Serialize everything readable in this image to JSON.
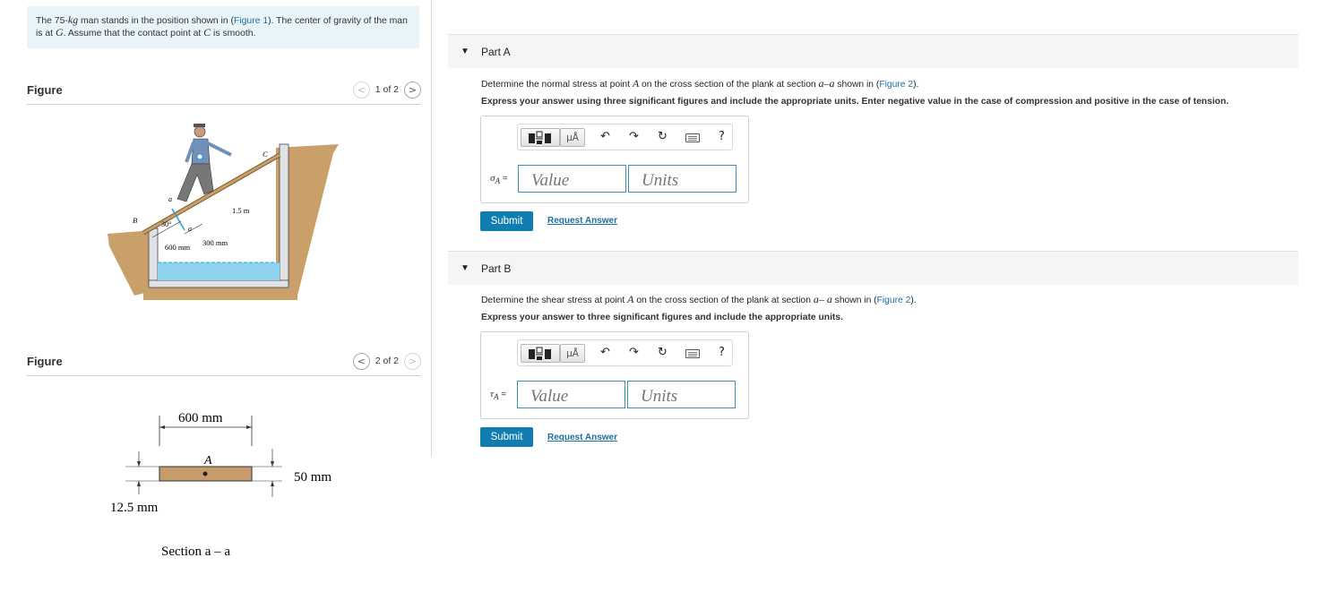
{
  "problem": {
    "t1": "The 75-",
    "kg": "kg",
    "t2": " man stands in the position shown in (",
    "fig1": "Figure 1",
    "t3": "). The center of gravity of the man is at ",
    "G": "G",
    "t4": ". Assume that the contact point at ",
    "C": "C",
    "t5": " is smooth."
  },
  "figures": [
    {
      "title": "Figure",
      "pager": "1 of 2",
      "prev": "<",
      "next": ">",
      "labels": {
        "C": "C",
        "a_top": "a",
        "a_bot": "a",
        "B": "B",
        "angle": "30°",
        "len": "1.5 m",
        "d600": "600 mm",
        "d300": "300 mm"
      }
    },
    {
      "title": "Figure",
      "pager": "2 of 2",
      "prev": "<",
      "next": ">",
      "labels": {
        "width": "600 mm",
        "A": "A",
        "height": "50 mm",
        "thick": "12.5 mm",
        "caption": "Section a – a"
      }
    }
  ],
  "parts": [
    {
      "label": "Part A",
      "q1": "Determine the normal stress at point ",
      "A": "A",
      "q2": " on the cross section of the plank at section ",
      "aa": "a–a",
      "q3": " shown in (",
      "fig": "Figure 2",
      "q4": ").",
      "instruction": "Express your answer using three significant figures and include the appropriate units. Enter negative value in the case of compression and positive in the case of tension.",
      "symbol": "σ",
      "sub": "A",
      "eq": " =",
      "value_placeholder": "Value",
      "units_placeholder": "Units",
      "submit": "Submit",
      "request": "Request Answer"
    },
    {
      "label": "Part B",
      "q1": "Determine the shear stress at point ",
      "A": "A",
      "q2": " on the cross section of the plank at section ",
      "aa": "a– a",
      "q3": " shown in (",
      "fig": "Figure 2",
      "q4": ").",
      "instruction": "Express your answer to three significant figures and include the appropriate units.",
      "symbol": "τ",
      "sub": "A",
      "eq": " =",
      "value_placeholder": "Value",
      "units_placeholder": "Units",
      "submit": "Submit",
      "request": "Request Answer"
    }
  ],
  "toolbar": {
    "units_glyph": "μÅ",
    "undo": "↶",
    "redo": "↷",
    "reset": "↻",
    "help": "?"
  }
}
